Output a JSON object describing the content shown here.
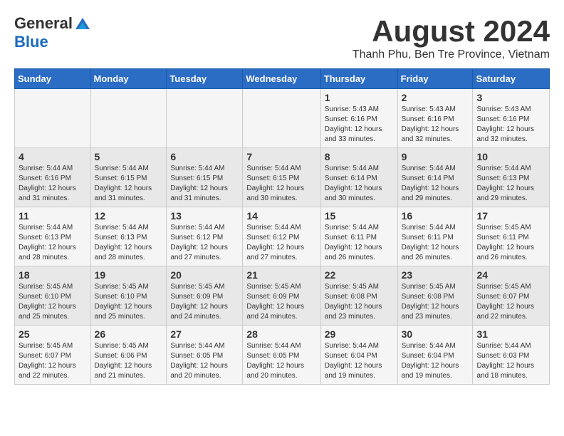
{
  "logo": {
    "general": "General",
    "blue": "Blue"
  },
  "title": "August 2024",
  "subtitle": "Thanh Phu, Ben Tre Province, Vietnam",
  "days_of_week": [
    "Sunday",
    "Monday",
    "Tuesday",
    "Wednesday",
    "Thursday",
    "Friday",
    "Saturday"
  ],
  "weeks": [
    [
      {
        "day": "",
        "info": ""
      },
      {
        "day": "",
        "info": ""
      },
      {
        "day": "",
        "info": ""
      },
      {
        "day": "",
        "info": ""
      },
      {
        "day": "1",
        "info": "Sunrise: 5:43 AM\nSunset: 6:16 PM\nDaylight: 12 hours\nand 33 minutes."
      },
      {
        "day": "2",
        "info": "Sunrise: 5:43 AM\nSunset: 6:16 PM\nDaylight: 12 hours\nand 32 minutes."
      },
      {
        "day": "3",
        "info": "Sunrise: 5:43 AM\nSunset: 6:16 PM\nDaylight: 12 hours\nand 32 minutes."
      }
    ],
    [
      {
        "day": "4",
        "info": "Sunrise: 5:44 AM\nSunset: 6:16 PM\nDaylight: 12 hours\nand 31 minutes."
      },
      {
        "day": "5",
        "info": "Sunrise: 5:44 AM\nSunset: 6:15 PM\nDaylight: 12 hours\nand 31 minutes."
      },
      {
        "day": "6",
        "info": "Sunrise: 5:44 AM\nSunset: 6:15 PM\nDaylight: 12 hours\nand 31 minutes."
      },
      {
        "day": "7",
        "info": "Sunrise: 5:44 AM\nSunset: 6:15 PM\nDaylight: 12 hours\nand 30 minutes."
      },
      {
        "day": "8",
        "info": "Sunrise: 5:44 AM\nSunset: 6:14 PM\nDaylight: 12 hours\nand 30 minutes."
      },
      {
        "day": "9",
        "info": "Sunrise: 5:44 AM\nSunset: 6:14 PM\nDaylight: 12 hours\nand 29 minutes."
      },
      {
        "day": "10",
        "info": "Sunrise: 5:44 AM\nSunset: 6:13 PM\nDaylight: 12 hours\nand 29 minutes."
      }
    ],
    [
      {
        "day": "11",
        "info": "Sunrise: 5:44 AM\nSunset: 6:13 PM\nDaylight: 12 hours\nand 28 minutes."
      },
      {
        "day": "12",
        "info": "Sunrise: 5:44 AM\nSunset: 6:13 PM\nDaylight: 12 hours\nand 28 minutes."
      },
      {
        "day": "13",
        "info": "Sunrise: 5:44 AM\nSunset: 6:12 PM\nDaylight: 12 hours\nand 27 minutes."
      },
      {
        "day": "14",
        "info": "Sunrise: 5:44 AM\nSunset: 6:12 PM\nDaylight: 12 hours\nand 27 minutes."
      },
      {
        "day": "15",
        "info": "Sunrise: 5:44 AM\nSunset: 6:11 PM\nDaylight: 12 hours\nand 26 minutes."
      },
      {
        "day": "16",
        "info": "Sunrise: 5:44 AM\nSunset: 6:11 PM\nDaylight: 12 hours\nand 26 minutes."
      },
      {
        "day": "17",
        "info": "Sunrise: 5:45 AM\nSunset: 6:11 PM\nDaylight: 12 hours\nand 26 minutes."
      }
    ],
    [
      {
        "day": "18",
        "info": "Sunrise: 5:45 AM\nSunset: 6:10 PM\nDaylight: 12 hours\nand 25 minutes."
      },
      {
        "day": "19",
        "info": "Sunrise: 5:45 AM\nSunset: 6:10 PM\nDaylight: 12 hours\nand 25 minutes."
      },
      {
        "day": "20",
        "info": "Sunrise: 5:45 AM\nSunset: 6:09 PM\nDaylight: 12 hours\nand 24 minutes."
      },
      {
        "day": "21",
        "info": "Sunrise: 5:45 AM\nSunset: 6:09 PM\nDaylight: 12 hours\nand 24 minutes."
      },
      {
        "day": "22",
        "info": "Sunrise: 5:45 AM\nSunset: 6:08 PM\nDaylight: 12 hours\nand 23 minutes."
      },
      {
        "day": "23",
        "info": "Sunrise: 5:45 AM\nSunset: 6:08 PM\nDaylight: 12 hours\nand 23 minutes."
      },
      {
        "day": "24",
        "info": "Sunrise: 5:45 AM\nSunset: 6:07 PM\nDaylight: 12 hours\nand 22 minutes."
      }
    ],
    [
      {
        "day": "25",
        "info": "Sunrise: 5:45 AM\nSunset: 6:07 PM\nDaylight: 12 hours\nand 22 minutes."
      },
      {
        "day": "26",
        "info": "Sunrise: 5:45 AM\nSunset: 6:06 PM\nDaylight: 12 hours\nand 21 minutes."
      },
      {
        "day": "27",
        "info": "Sunrise: 5:44 AM\nSunset: 6:05 PM\nDaylight: 12 hours\nand 20 minutes."
      },
      {
        "day": "28",
        "info": "Sunrise: 5:44 AM\nSunset: 6:05 PM\nDaylight: 12 hours\nand 20 minutes."
      },
      {
        "day": "29",
        "info": "Sunrise: 5:44 AM\nSunset: 6:04 PM\nDaylight: 12 hours\nand 19 minutes."
      },
      {
        "day": "30",
        "info": "Sunrise: 5:44 AM\nSunset: 6:04 PM\nDaylight: 12 hours\nand 19 minutes."
      },
      {
        "day": "31",
        "info": "Sunrise: 5:44 AM\nSunset: 6:03 PM\nDaylight: 12 hours\nand 18 minutes."
      }
    ]
  ]
}
